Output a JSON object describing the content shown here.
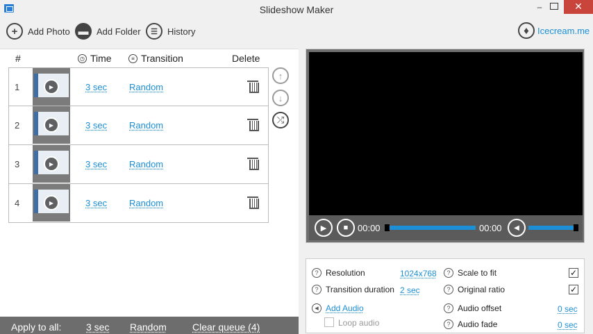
{
  "window": {
    "title": "Slideshow Maker",
    "minimize": "–",
    "close": "✕"
  },
  "toolbar": {
    "add_photo": "Add Photo",
    "add_folder": "Add Folder",
    "history": "History",
    "site_link": "Icecream.me"
  },
  "table": {
    "headers": {
      "num": "#",
      "time": "Time",
      "transition": "Transition",
      "delete": "Delete"
    },
    "rows": [
      {
        "num": "1",
        "time": "3 sec",
        "transition": "Random"
      },
      {
        "num": "2",
        "time": "3 sec",
        "transition": "Random"
      },
      {
        "num": "3",
        "time": "3 sec",
        "transition": "Random"
      },
      {
        "num": "4",
        "time": "3 sec",
        "transition": "Random"
      }
    ]
  },
  "apply_bar": {
    "label": "Apply to all:",
    "time": "3 sec",
    "transition": "Random",
    "clear": "Clear queue (4)"
  },
  "player": {
    "current_time": "00:00",
    "total_time": "00:00",
    "progress": 0,
    "volume": 1.0
  },
  "settings": {
    "resolution_label": "Resolution",
    "resolution_value": "1024x768",
    "transition_duration_label": "Transition duration",
    "transition_duration_value": "2 sec",
    "add_audio": "Add Audio",
    "loop_audio": "Loop audio",
    "scale_to_fit": "Scale to fit",
    "original_ratio": "Original ratio",
    "audio_offset_label": "Audio offset",
    "audio_offset_value": "0 sec",
    "audio_fade_label": "Audio fade",
    "audio_fade_value": "0 sec",
    "scale_to_fit_checked": true,
    "original_ratio_checked": true,
    "loop_audio_checked": false
  },
  "colors": {
    "accent": "#1c8fd6",
    "close": "#c9443a",
    "player_bg": "#6f6f6f"
  }
}
